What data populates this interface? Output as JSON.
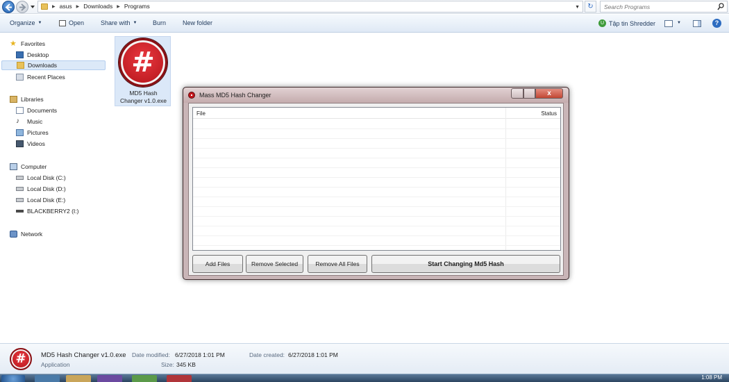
{
  "address_bar": {
    "breadcrumbs": [
      "asus",
      "Downloads",
      "Programs"
    ],
    "search_placeholder": "Search Programs"
  },
  "toolbar": {
    "organize": "Organize",
    "open": "Open",
    "share_with": "Share with",
    "burn": "Burn",
    "new_folder": "New folder",
    "shredder": "Tập tin Shredder"
  },
  "nav": {
    "favorites": "Favorites",
    "desktop": "Desktop",
    "downloads": "Downloads",
    "recent_places": "Recent Places",
    "libraries": "Libraries",
    "documents": "Documents",
    "music": "Music",
    "pictures": "Pictures",
    "videos": "Videos",
    "computer": "Computer",
    "disk_c": "Local Disk (C:)",
    "disk_d": "Local Disk (D:)",
    "disk_e": "Local Disk (E:)",
    "blackberry": "BLACKBERRY2 (I:)",
    "network": "Network"
  },
  "file": {
    "name_line1": "MD5 Hash",
    "name_line2": "Changer v1.0.exe"
  },
  "dialog": {
    "title": "Mass MD5 Hash Changer",
    "columns": {
      "file": "File",
      "status": "Status"
    },
    "buttons": {
      "add_files": "Add Files",
      "remove_selected": "Remove Selected",
      "remove_all": "Remove All Files",
      "start": "Start Changing Md5 Hash"
    }
  },
  "details": {
    "name": "MD5 Hash Changer v1.0.exe",
    "type": "Application",
    "date_modified_label": "Date modified:",
    "date_modified": "6/27/2018 1:01 PM",
    "size_label": "Size:",
    "size": "345 KB",
    "date_created_label": "Date created:",
    "date_created": "6/27/2018 1:01 PM"
  },
  "taskbar": {
    "clock": "1:08 PM"
  },
  "colors": {
    "accent_blue": "#2d6cc0",
    "app_red": "#c4161c",
    "dialog_frame": "#c9b5b7"
  }
}
